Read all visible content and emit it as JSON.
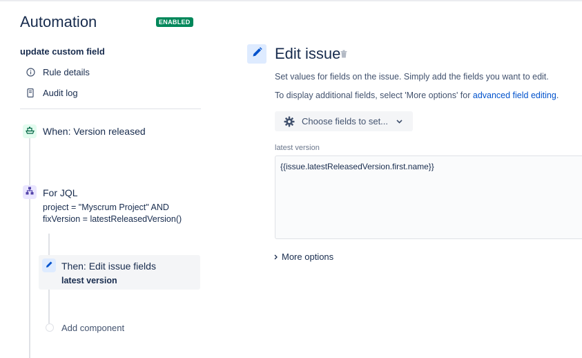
{
  "header": {
    "app_title": "Automation",
    "status_badge": "ENABLED",
    "status_color": "#00875a"
  },
  "rule": {
    "name": "update custom field",
    "menu": [
      {
        "label": "Rule details",
        "icon": "info-icon"
      },
      {
        "label": "Audit log",
        "icon": "document-icon"
      }
    ]
  },
  "steps": {
    "trigger": {
      "label": "When: Version released",
      "icon": "ship-icon",
      "color": "#e3fcef"
    },
    "branch": {
      "label": "For JQL",
      "query_line1": "project = \"Myscrum Project\" AND",
      "query_line2": "fixVersion = latestReleasedVersion()",
      "icon": "branch-icon",
      "color": "#eae6ff"
    },
    "action": {
      "label": "Then: Edit issue fields",
      "detail": "latest version",
      "icon": "pencil-icon",
      "color": "#deebff"
    },
    "add_component": "Add component"
  },
  "editor": {
    "title": "Edit issue",
    "description1": "Set values for fields on the issue. Simply add the fields you want to edit.",
    "description2_prefix": "To display additional fields, select 'More options' for ",
    "description2_link": "advanced field editing",
    "description2_suffix": ".",
    "choose_fields_label": "Choose fields to set...",
    "field_label": "latest version",
    "field_value": "{{issue.latestReleasedVersion.first.name}}",
    "more_options": "More options"
  }
}
